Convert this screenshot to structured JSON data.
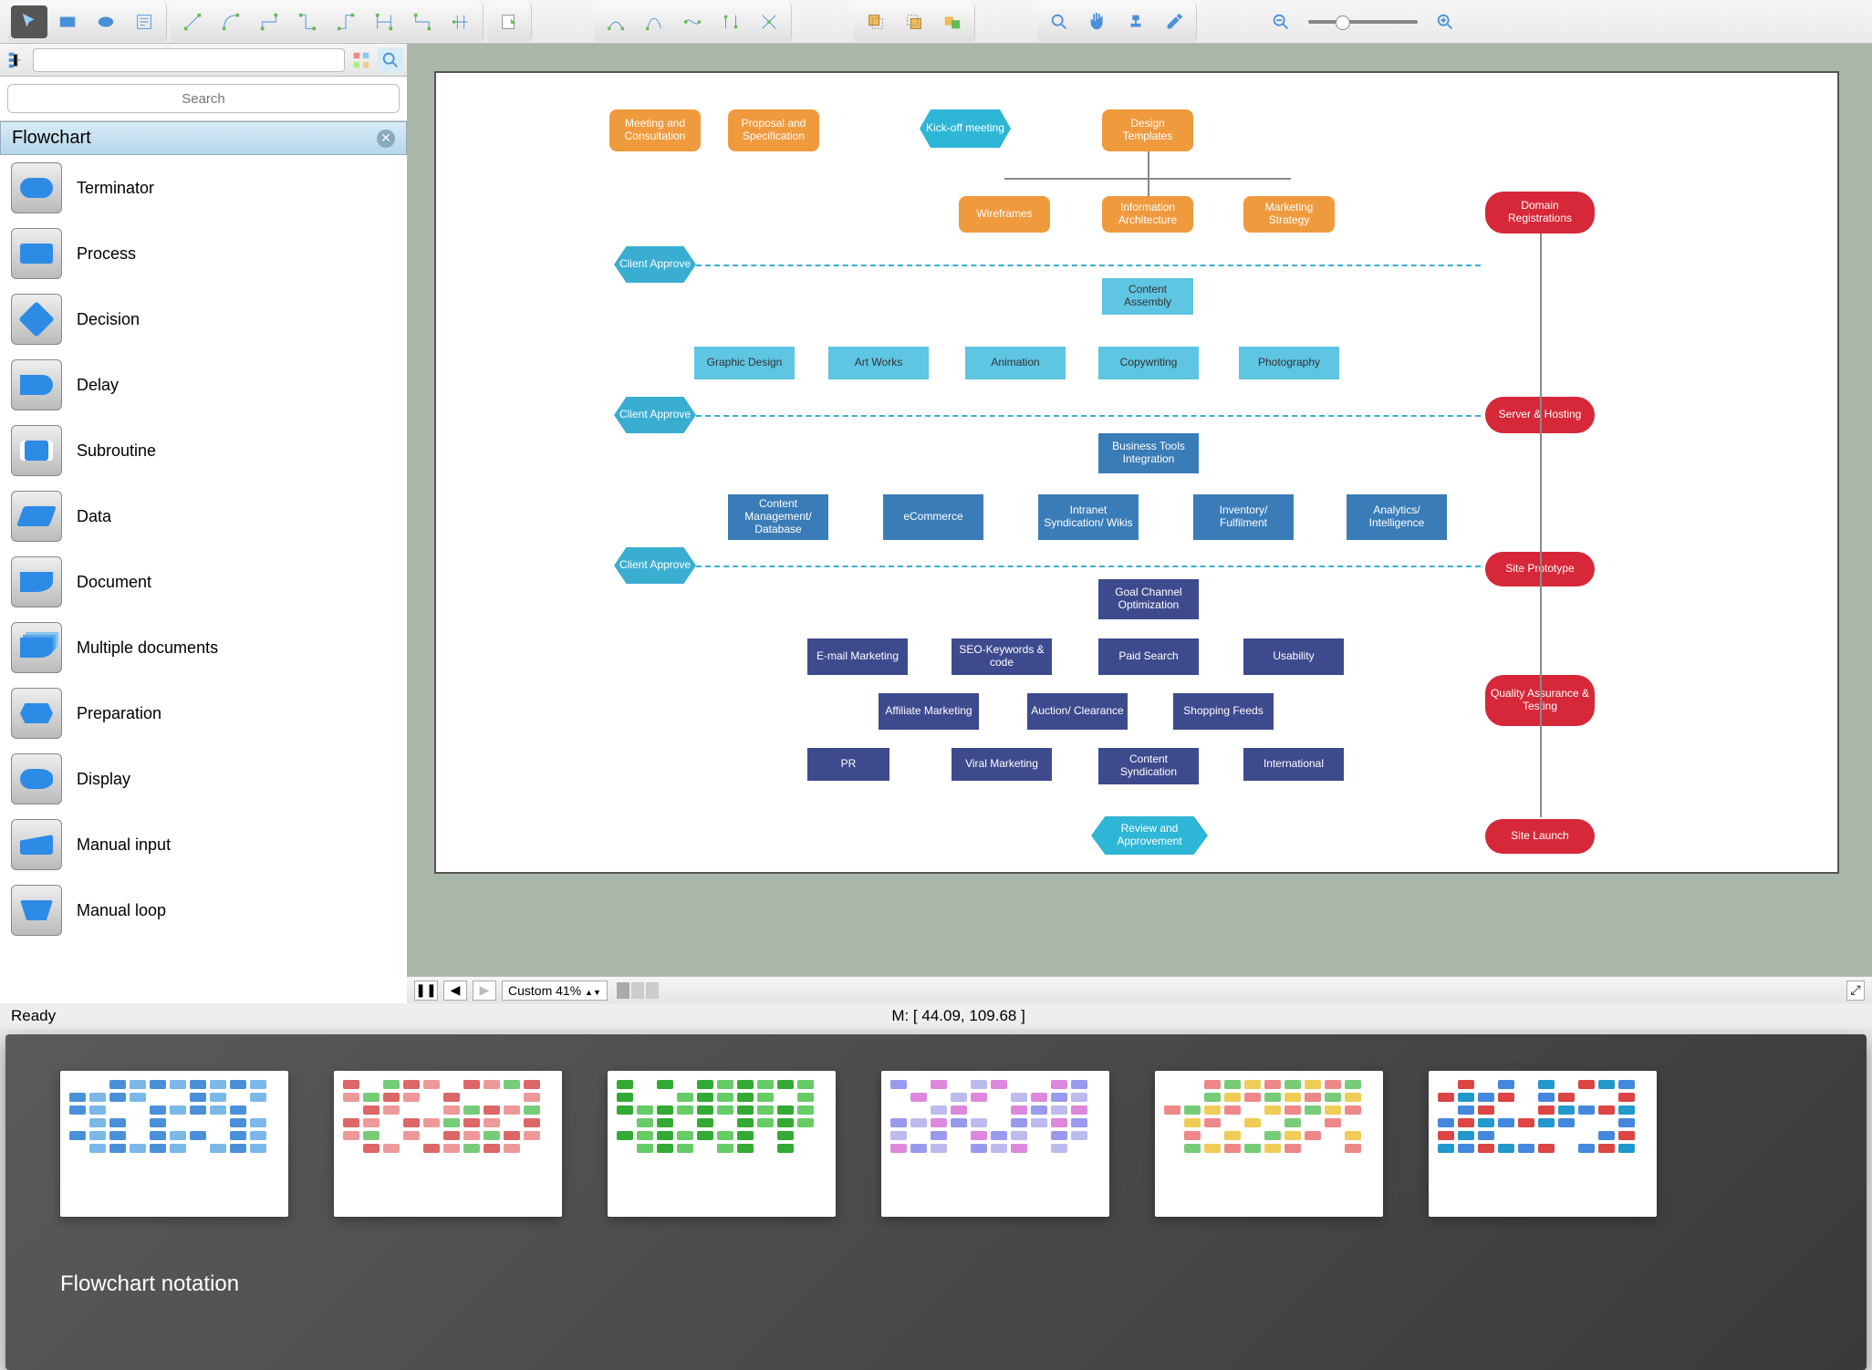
{
  "toolbar": {
    "groups": [
      [
        "pointer",
        "rectangle",
        "ellipse",
        "text"
      ],
      [
        "connector1",
        "connector2",
        "connector3",
        "connector4",
        "connector5",
        "connector6",
        "connector7",
        "connector8"
      ],
      [
        "insert"
      ],
      [
        "curve1",
        "curve2",
        "curve3",
        "align1",
        "align2"
      ],
      [
        "layer1",
        "layer2",
        "layer3"
      ],
      [
        "zoom-in",
        "pan",
        "ruler",
        "picker"
      ],
      [
        "zoom-out-btn",
        "zoom-slider",
        "zoom-in-btn"
      ]
    ]
  },
  "panel": {
    "search_placeholder": "Search",
    "section_title": "Flowchart",
    "shapes": [
      {
        "key": "terminator",
        "label": "Terminator"
      },
      {
        "key": "process",
        "label": "Process"
      },
      {
        "key": "decision",
        "label": "Decision"
      },
      {
        "key": "delay",
        "label": "Delay"
      },
      {
        "key": "subroutine",
        "label": "Subroutine"
      },
      {
        "key": "data",
        "label": "Data"
      },
      {
        "key": "document",
        "label": "Document"
      },
      {
        "key": "multidoc",
        "label": "Multiple documents"
      },
      {
        "key": "prep",
        "label": "Preparation"
      },
      {
        "key": "display",
        "label": "Display"
      },
      {
        "key": "minput",
        "label": "Manual input"
      },
      {
        "key": "mloop",
        "label": "Manual loop"
      }
    ]
  },
  "canvas": {
    "zoom_label": "Custom 41%",
    "nodes": {
      "meeting": "Meeting and Consultation",
      "proposal": "Proposal and Specification",
      "kickoff": "Kick-off meeting",
      "design": "Design Templates",
      "wireframes": "Wireframes",
      "ia": "Information Architecture",
      "marketing": "Marketing Strategy",
      "domain": "Domain Registrations",
      "approve1": "Client Approve",
      "content_assembly": "Content Assembly",
      "graphic": "Graphic Design",
      "artworks": "Art Works",
      "animation": "Animation",
      "copy": "Copywriting",
      "photo": "Photography",
      "approve2": "Client Approve",
      "server": "Server & Hosting",
      "biztools": "Business Tools Integration",
      "cms": "Content Management/ Database",
      "ecom": "eCommerce",
      "intranet": "Intranet Syndication/ Wikis",
      "inventory": "Inventory/ Fulfilment",
      "analytics": "Analytics/ Intelligence",
      "approve3": "Client Approve",
      "prototype": "Site Prototype",
      "goal": "Goal Channel Optimization",
      "email": "E-mail Marketing",
      "seo": "SEO-Keywords & code",
      "paid": "Paid Search",
      "usability": "Usability",
      "affiliate": "Affiliate Marketing",
      "auction": "Auction/ Clearance",
      "shopping": "Shopping Feeds",
      "pr": "PR",
      "viral": "Viral Marketing",
      "syndication": "Content Syndication",
      "intl": "International",
      "qa": "Quality Assurance & Testing",
      "review": "Review and Approvement",
      "launch": "Site Launch"
    }
  },
  "status": {
    "ready": "Ready",
    "mouse": "M: [ 44.09, 109.68 ]"
  },
  "gallery": {
    "title": "Flowchart notation"
  }
}
